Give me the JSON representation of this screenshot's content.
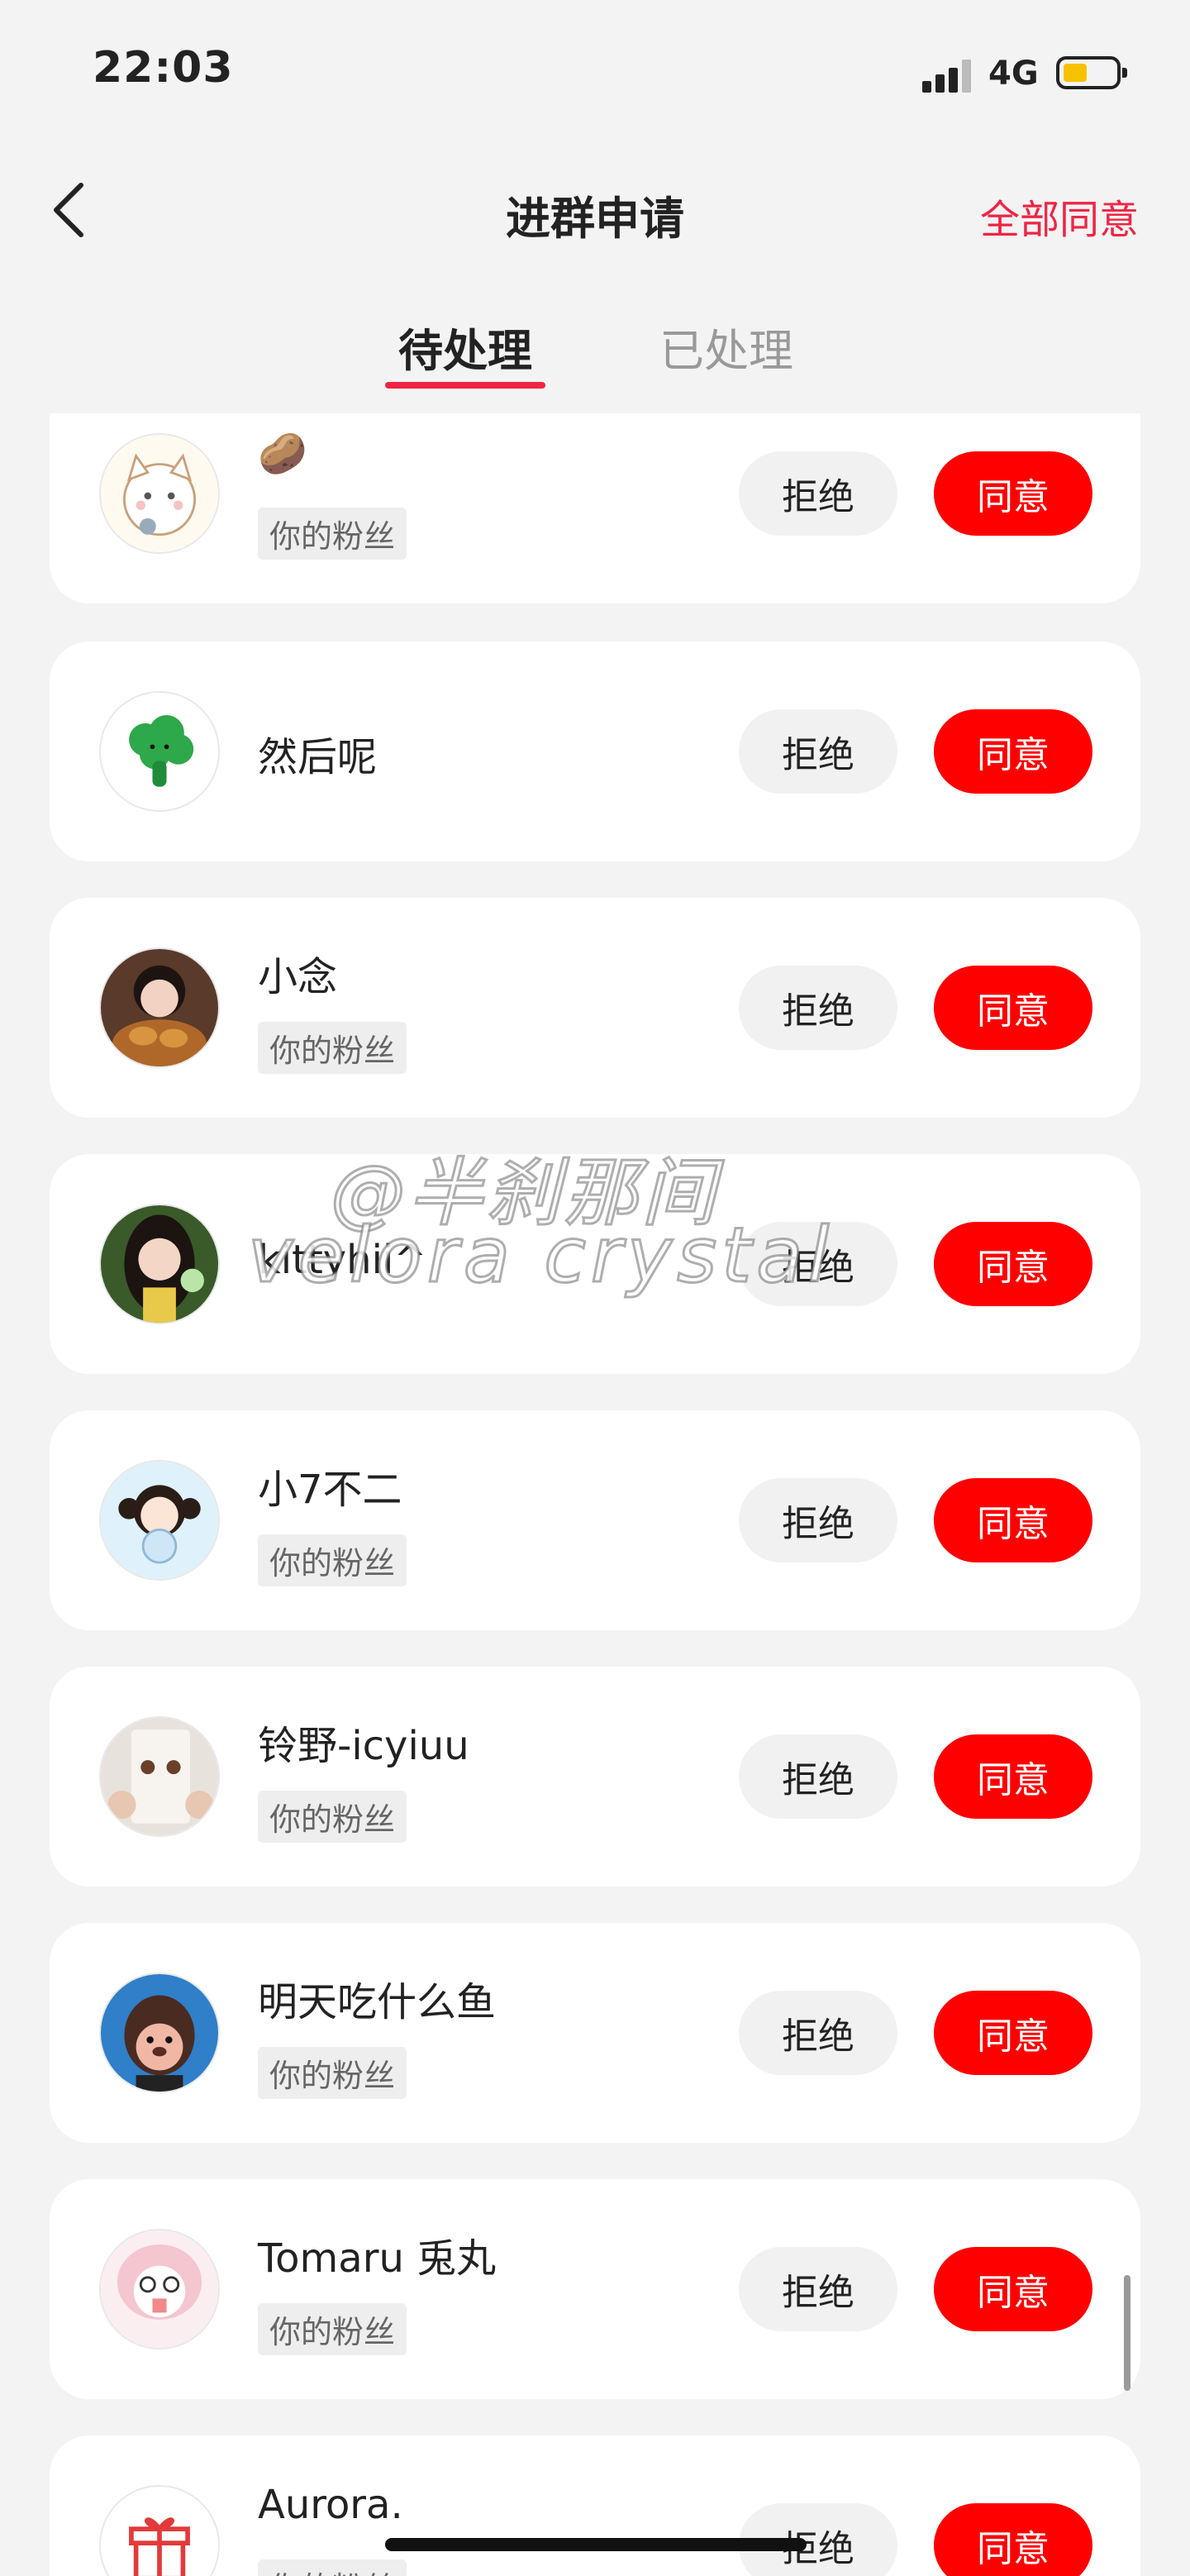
{
  "status_bar": {
    "time": "22:03",
    "network": "4G"
  },
  "nav": {
    "title": "进群申请",
    "approve_all": "全部同意"
  },
  "tabs": [
    {
      "label": "待处理",
      "active": true
    },
    {
      "label": "已处理",
      "active": false
    }
  ],
  "buttons": {
    "reject": "拒绝",
    "accept": "同意"
  },
  "requests": [
    {
      "name": "🥔",
      "tag": "你的粉丝"
    },
    {
      "name": "然后呢",
      "tag": ""
    },
    {
      "name": "小念",
      "tag": "你的粉丝"
    },
    {
      "name": "kittyhii^",
      "tag": ""
    },
    {
      "name": "小7不二",
      "tag": "你的粉丝"
    },
    {
      "name": "铃野-icyiuu",
      "tag": "你的粉丝"
    },
    {
      "name": "明天吃什么鱼",
      "tag": "你的粉丝"
    },
    {
      "name": "Tomaru 兎丸",
      "tag": "你的粉丝"
    },
    {
      "name": "Aurora.",
      "tag": "你的粉丝"
    }
  ],
  "watermark": {
    "line1": "@半刹那间",
    "line2": "velora crystal"
  },
  "colors": {
    "accent": "#ee2545",
    "accept_button": "#fe0000",
    "background": "#f3f3f3"
  }
}
